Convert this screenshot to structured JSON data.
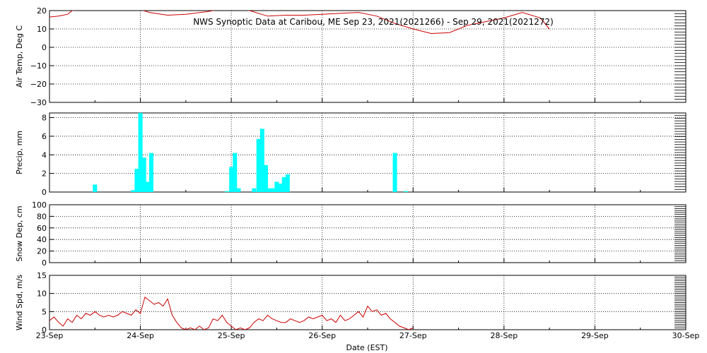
{
  "chart_data": [
    {
      "type": "line",
      "title": "NWS Synoptic Data at Caribou, ME   Sep 23, 2021(2021266) - Sep 29, 2021(2021272)",
      "ylabel": "Air Temp, Deg C",
      "ylim": [
        -30,
        20
      ],
      "yticks": [
        "20",
        "10",
        "0",
        "−10",
        "−20",
        "−30"
      ],
      "grid": true,
      "series": [
        {
          "color": "#cc0000",
          "x": [
            0,
            0.1,
            0.2,
            0.25,
            0.35,
            0.5,
            0.7,
            0.9,
            1.0,
            1.1,
            1.3,
            1.5,
            1.75,
            1.9,
            2.0,
            2.2,
            2.4,
            2.6,
            2.8,
            3.0,
            3.2,
            3.4,
            3.6,
            3.8,
            4.0,
            4.2,
            4.4,
            4.6,
            4.8,
            5.0,
            5.2,
            5.4,
            5.5
          ],
          "y": [
            16.5,
            17,
            18,
            20,
            20.5,
            21,
            21,
            21,
            20.5,
            19,
            17.5,
            18,
            19.5,
            21,
            21.5,
            20,
            17,
            17.5,
            17.5,
            18,
            18.5,
            19,
            17,
            13,
            10,
            7.5,
            8,
            12,
            14,
            16,
            19,
            16,
            10
          ]
        }
      ]
    },
    {
      "type": "bar",
      "ylabel": "Precip, mm",
      "ylim": [
        0,
        8.5
      ],
      "yticks": [
        "8",
        "6",
        "4",
        "2",
        "0"
      ],
      "grid": true,
      "color": "#00ffff",
      "x": [
        0.5,
        0.92,
        0.96,
        1.0,
        1.04,
        1.08,
        1.12,
        1.95,
        2.0,
        2.04,
        2.08,
        2.25,
        2.3,
        2.34,
        2.38,
        2.42,
        2.46,
        2.5,
        2.54,
        2.58,
        2.62,
        3.8,
        3.92
      ],
      "values": [
        0.8,
        0.2,
        2.5,
        8.8,
        3.7,
        1.1,
        4.2,
        0.1,
        2.7,
        4.2,
        0.4,
        0.4,
        5.7,
        6.8,
        2.9,
        0.4,
        0.4,
        1.1,
        0.9,
        1.6,
        1.9,
        4.2,
        0.1
      ]
    },
    {
      "type": "line",
      "ylabel": "Snow Dep, cm",
      "ylim": [
        0,
        100
      ],
      "yticks": [
        "100",
        "80",
        "60",
        "40",
        "20",
        "0"
      ],
      "grid": true,
      "series": []
    },
    {
      "type": "line",
      "ylabel": "Wind Spd, m/s",
      "xlabel": "Date (EST)",
      "ylim": [
        0,
        15
      ],
      "yticks": [
        "15",
        "10",
        "5",
        "0"
      ],
      "xticks": [
        "23-Sep",
        "24-Sep",
        "25-Sep",
        "26-Sep",
        "27-Sep",
        "28-Sep",
        "29-Sep",
        "30-Sep"
      ],
      "grid": true,
      "series": [
        {
          "color": "#cc0000",
          "x": [
            0,
            0.05,
            0.1,
            0.15,
            0.2,
            0.25,
            0.3,
            0.35,
            0.4,
            0.45,
            0.5,
            0.55,
            0.6,
            0.65,
            0.7,
            0.75,
            0.8,
            0.85,
            0.9,
            0.95,
            1.0,
            1.05,
            1.1,
            1.15,
            1.2,
            1.25,
            1.3,
            1.35,
            1.4,
            1.45,
            1.5,
            1.55,
            1.6,
            1.65,
            1.7,
            1.75,
            1.8,
            1.85,
            1.9,
            1.95,
            2.0,
            2.05,
            2.1,
            2.15,
            2.2,
            2.25,
            2.3,
            2.35,
            2.4,
            2.45,
            2.5,
            2.55,
            2.6,
            2.65,
            2.7,
            2.75,
            2.8,
            2.85,
            2.9,
            2.95,
            3.0,
            3.05,
            3.1,
            3.15,
            3.2,
            3.25,
            3.3,
            3.35,
            3.4,
            3.45,
            3.5,
            3.55,
            3.6,
            3.65,
            3.7,
            3.75,
            3.8,
            3.85,
            3.9,
            3.95,
            4.0
          ],
          "y": [
            2.5,
            3.5,
            2,
            1,
            3,
            2,
            4,
            3,
            4.5,
            4,
            5,
            4,
            3.5,
            4,
            3.5,
            4,
            5,
            4.5,
            4,
            5.5,
            4.5,
            9,
            8,
            7,
            7.5,
            6.5,
            8.5,
            4,
            2,
            0.5,
            0,
            0.5,
            0,
            1,
            0,
            0.5,
            3,
            2.5,
            4,
            2,
            1,
            0,
            0.5,
            0,
            0.5,
            2,
            3,
            2.5,
            4,
            3,
            2.5,
            2,
            2,
            3,
            2.5,
            2,
            2.5,
            3.5,
            3,
            3.5,
            4,
            2.5,
            3,
            2,
            4,
            2.5,
            3,
            4,
            5,
            3.5,
            6.5,
            5,
            5.5,
            4,
            4.5,
            3,
            2,
            1,
            0.5,
            0,
            0.5
          ]
        }
      ]
    }
  ]
}
